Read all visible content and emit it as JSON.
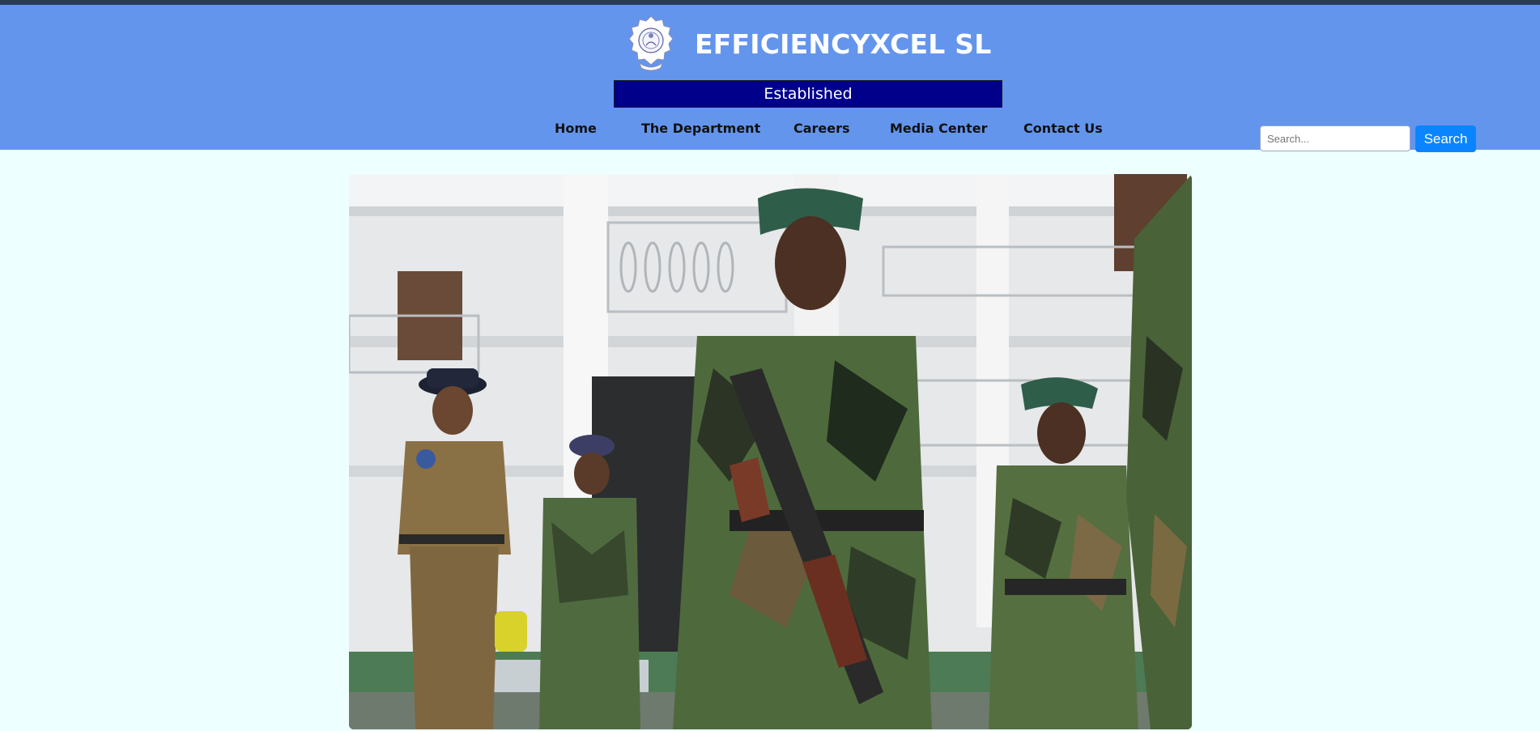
{
  "site": {
    "title": "EFFICIENCYXCEL SL",
    "tagline": "Established",
    "logo_icon": "police-emblem-icon"
  },
  "nav": {
    "items": [
      {
        "label": "Home"
      },
      {
        "label": "The Department"
      },
      {
        "label": "Careers"
      },
      {
        "label": "Media Center"
      },
      {
        "label": "Contact Us"
      }
    ]
  },
  "search": {
    "placeholder": "Search...",
    "button_label": "Search"
  },
  "hero": {
    "alt": "Security personnel outside a building"
  },
  "colors": {
    "header_bg": "#6495ed",
    "tagline_bg": "#00008b",
    "page_bg": "#eeffff",
    "search_button": "#0a84ff"
  }
}
